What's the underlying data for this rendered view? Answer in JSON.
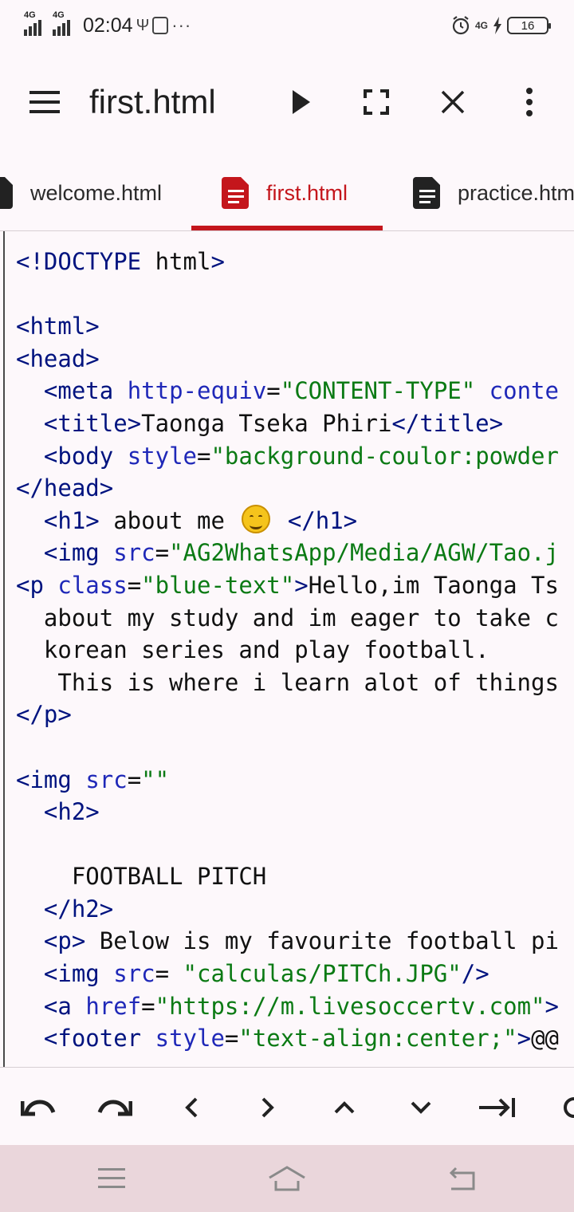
{
  "status_bar": {
    "net1": "4G",
    "net2": "4G",
    "time": "02:04",
    "usb_glyph": "Ψ",
    "dots": "···",
    "right_net": "4G",
    "battery": "16"
  },
  "toolbar": {
    "title": "first.html",
    "icons": [
      "menu-icon",
      "play-icon",
      "fullscreen-icon",
      "close-icon",
      "more-vert-icon"
    ]
  },
  "tabs": [
    {
      "label": "welcome.html",
      "active": false
    },
    {
      "label": "first.html",
      "active": true
    },
    {
      "label": "practice.htm",
      "active": false
    }
  ],
  "colors": {
    "accent": "#c4161c",
    "tag": "#00137f",
    "attribute": "#1f28b8",
    "string": "#0b7a14"
  },
  "code_lines": [
    [
      {
        "c": "t",
        "t": "<!DOCTYPE"
      },
      {
        "c": "x",
        "t": " html"
      },
      {
        "c": "t",
        "t": ">"
      }
    ],
    [],
    [
      {
        "c": "t",
        "t": "<html>"
      }
    ],
    [
      {
        "c": "t",
        "t": "<head>"
      }
    ],
    [
      {
        "c": "t",
        "t": "  <meta "
      },
      {
        "c": "a",
        "t": "http-equiv"
      },
      {
        "c": "x",
        "t": "="
      },
      {
        "c": "s",
        "t": "\"CONTENT-TYPE\""
      },
      {
        "c": "a",
        "t": " conte"
      }
    ],
    [
      {
        "c": "t",
        "t": "  <title>"
      },
      {
        "c": "x",
        "t": "Taonga Tseka Phiri"
      },
      {
        "c": "t",
        "t": "</title>"
      }
    ],
    [
      {
        "c": "t",
        "t": "  <body "
      },
      {
        "c": "a",
        "t": "style"
      },
      {
        "c": "x",
        "t": "="
      },
      {
        "c": "s",
        "t": "\"background-coulor:powder"
      }
    ],
    [
      {
        "c": "t",
        "t": "</head>"
      }
    ],
    [
      {
        "c": "t",
        "t": "  <h1>"
      },
      {
        "c": "x",
        "t": " about me "
      },
      {
        "c": "emoji",
        "t": "😊"
      },
      {
        "c": "x",
        "t": " "
      },
      {
        "c": "t",
        "t": "</h1>"
      }
    ],
    [
      {
        "c": "t",
        "t": "  <img "
      },
      {
        "c": "a",
        "t": "src"
      },
      {
        "c": "x",
        "t": "="
      },
      {
        "c": "s",
        "t": "\"AG2WhatsApp/Media/AGW/Tao.j"
      }
    ],
    [
      {
        "c": "t",
        "t": "<p "
      },
      {
        "c": "a",
        "t": "class"
      },
      {
        "c": "x",
        "t": "="
      },
      {
        "c": "s",
        "t": "\"blue-text\""
      },
      {
        "c": "t",
        "t": ">"
      },
      {
        "c": "x",
        "t": "Hello,im Taonga Ts"
      }
    ],
    [
      {
        "c": "x",
        "t": "  about my study and im eager to take c"
      }
    ],
    [
      {
        "c": "x",
        "t": "  korean series and play football."
      }
    ],
    [
      {
        "c": "x",
        "t": "   This is where i learn alot of things"
      }
    ],
    [
      {
        "c": "t",
        "t": "</p>"
      }
    ],
    [],
    [
      {
        "c": "t",
        "t": "<img "
      },
      {
        "c": "a",
        "t": "src"
      },
      {
        "c": "x",
        "t": "="
      },
      {
        "c": "s",
        "t": "\"\""
      }
    ],
    [
      {
        "c": "t",
        "t": "  <h2>"
      }
    ],
    [],
    [
      {
        "c": "x",
        "t": "    FOOTBALL PITCH"
      }
    ],
    [
      {
        "c": "t",
        "t": "  </h2>"
      }
    ],
    [
      {
        "c": "t",
        "t": "  <p>"
      },
      {
        "c": "x",
        "t": " Below is my favourite football pi"
      }
    ],
    [
      {
        "c": "t",
        "t": "  <img "
      },
      {
        "c": "a",
        "t": "src"
      },
      {
        "c": "x",
        "t": "= "
      },
      {
        "c": "s",
        "t": "\"calculas/PITCh.JPG\""
      },
      {
        "c": "t",
        "t": "/>"
      }
    ],
    [
      {
        "c": "t",
        "t": "  <a "
      },
      {
        "c": "a",
        "t": "href"
      },
      {
        "c": "x",
        "t": "="
      },
      {
        "c": "s",
        "t": "\"https://m.livesoccertv.com\""
      },
      {
        "c": "t",
        "t": ">"
      }
    ],
    [
      {
        "c": "t",
        "t": "  <footer "
      },
      {
        "c": "a",
        "t": "style"
      },
      {
        "c": "x",
        "t": "="
      },
      {
        "c": "s",
        "t": "\"text-align:center;\""
      },
      {
        "c": "t",
        "t": ">"
      },
      {
        "c": "x",
        "t": "@@"
      }
    ]
  ],
  "keys": [
    "undo-icon",
    "redo-icon",
    "chevron-left-icon",
    "chevron-right-icon",
    "chevron-up-icon",
    "chevron-down-icon",
    "tab-icon"
  ],
  "nav": [
    "recents-icon",
    "home-icon",
    "back-icon"
  ]
}
